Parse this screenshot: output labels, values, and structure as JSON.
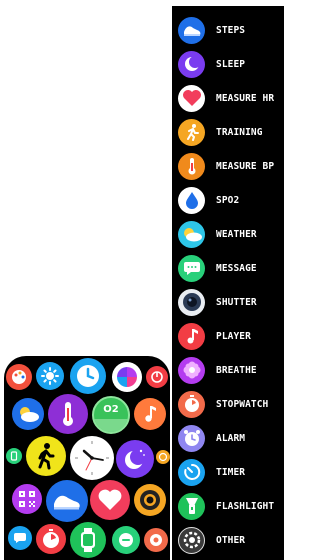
{
  "menu": {
    "items": [
      {
        "label": "STEPS",
        "icon": "shoe-icon",
        "color": "#1f6fe8"
      },
      {
        "label": "SLEEP",
        "icon": "moon-icon",
        "color": "#7a3cf0"
      },
      {
        "label": "MEASURE HR",
        "icon": "heart-icon",
        "color": "#f23d5c"
      },
      {
        "label": "TRAINING",
        "icon": "running-icon",
        "color": "#f5a623"
      },
      {
        "label": "MEASURE BP",
        "icon": "thermometer-icon",
        "color": "#f08a1c"
      },
      {
        "label": "SPO2",
        "icon": "droplet-icon",
        "color": "#ffffff"
      },
      {
        "label": "WEATHER",
        "icon": "sun-cloud-icon",
        "color": "#2ec6e8"
      },
      {
        "label": "MESSAGE",
        "icon": "chat-bubble-icon",
        "color": "#28d07a"
      },
      {
        "label": "SHUTTER",
        "icon": "camera-shutter-icon",
        "color": "#e9edf2"
      },
      {
        "label": "PLAYER",
        "icon": "music-note-icon",
        "color": "#f23d44"
      },
      {
        "label": "BREATHE",
        "icon": "flower-icon",
        "color": "#b43cf0"
      },
      {
        "label": "STOPWATCH",
        "icon": "stopwatch-icon",
        "color": "#f26a4a"
      },
      {
        "label": "ALARM",
        "icon": "alarm-clock-icon",
        "color": "#8f86f0"
      },
      {
        "label": "TIMER",
        "icon": "timer-icon",
        "color": "#1aa3f0"
      },
      {
        "label": "FLASHLIGHT",
        "icon": "flashlight-icon",
        "color": "#1fc25a"
      },
      {
        "label": "OTHER",
        "icon": "gear-icon",
        "color": "#3a3a3a"
      }
    ]
  },
  "watch": {
    "o2_label": "O2"
  }
}
